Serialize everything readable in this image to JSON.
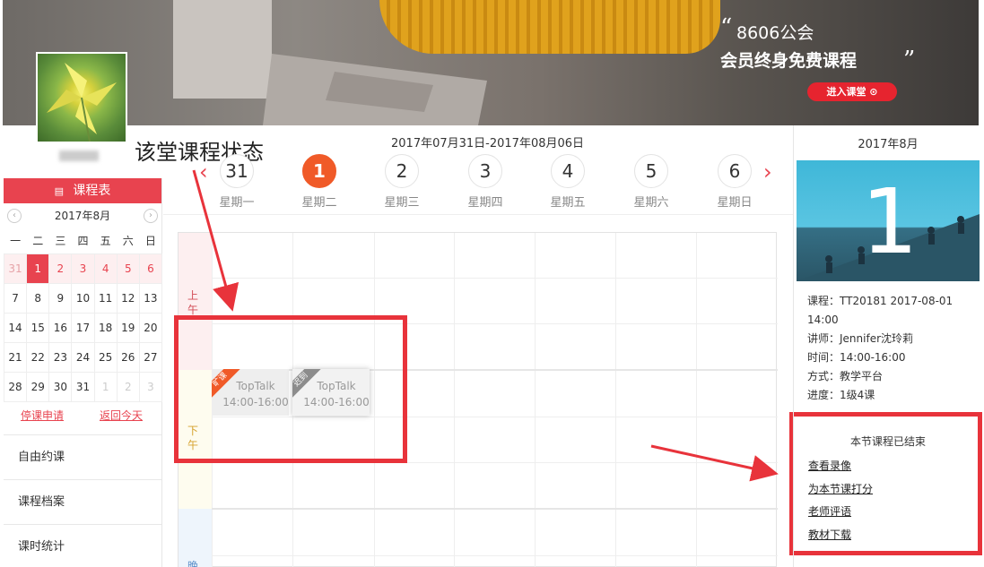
{
  "banner": {
    "line1": "8606公会",
    "line2": "会员终身免费课程",
    "quote_open": "“",
    "quote_close": "”",
    "enter_button": "进入课堂 ⊙"
  },
  "annotation": {
    "title": "该堂课程状态"
  },
  "sidebar": {
    "schedule_button": "课程表",
    "calendar_icon": "▤",
    "month_title": "2017年8月",
    "prev_icon": "‹",
    "next_icon": "›",
    "weekdays": [
      "一",
      "二",
      "三",
      "四",
      "五",
      "六",
      "日"
    ],
    "weeks": [
      [
        "31",
        "1",
        "2",
        "3",
        "4",
        "5",
        "6"
      ],
      [
        "7",
        "8",
        "9",
        "10",
        "11",
        "12",
        "13"
      ],
      [
        "14",
        "15",
        "16",
        "17",
        "18",
        "19",
        "20"
      ],
      [
        "21",
        "22",
        "23",
        "24",
        "25",
        "26",
        "27"
      ],
      [
        "28",
        "29",
        "30",
        "31",
        "1",
        "2",
        "3"
      ]
    ],
    "link_leave": "停课申请",
    "link_today": "返回今天",
    "menu": [
      "自由约课",
      "课程档案",
      "课时统计"
    ]
  },
  "week": {
    "range": "2017年07月31日-2017年08月06日",
    "prev": "‹",
    "next": "›",
    "days": [
      {
        "num": "31",
        "name": "星期一"
      },
      {
        "num": "1",
        "name": "星期二"
      },
      {
        "num": "2",
        "name": "星期三"
      },
      {
        "num": "3",
        "name": "星期四"
      },
      {
        "num": "4",
        "name": "星期五"
      },
      {
        "num": "5",
        "name": "星期六"
      },
      {
        "num": "6",
        "name": "星期日"
      }
    ],
    "selected_index": 1
  },
  "grid": {
    "am_label": "上午",
    "pm_label": "下午",
    "ev_label": "晚",
    "cards": [
      {
        "tag": "旷课",
        "tag_color": "#f05a28",
        "title": "TopTalk",
        "time": "14:00-16:00"
      },
      {
        "tag": "迟到",
        "tag_color": "#8c8c8c",
        "title": "TopTalk",
        "time": "14:00-16:00"
      }
    ]
  },
  "right": {
    "month": "2017年8月",
    "big_day": "1",
    "info": [
      "课程：TT20181 2017-08-01 14:00",
      "讲师：Jennifer沈玲莉",
      "时间：14:00-16:00",
      "方式：教学平台",
      "进度：1级4课"
    ],
    "status": "本节课程已结束",
    "links": [
      "查看录像",
      "为本节课打分",
      "老师评语",
      "教材下载"
    ]
  },
  "colors": {
    "accent": "#e8434f",
    "annotation_red": "#e8333b",
    "today": "#f05a28"
  }
}
